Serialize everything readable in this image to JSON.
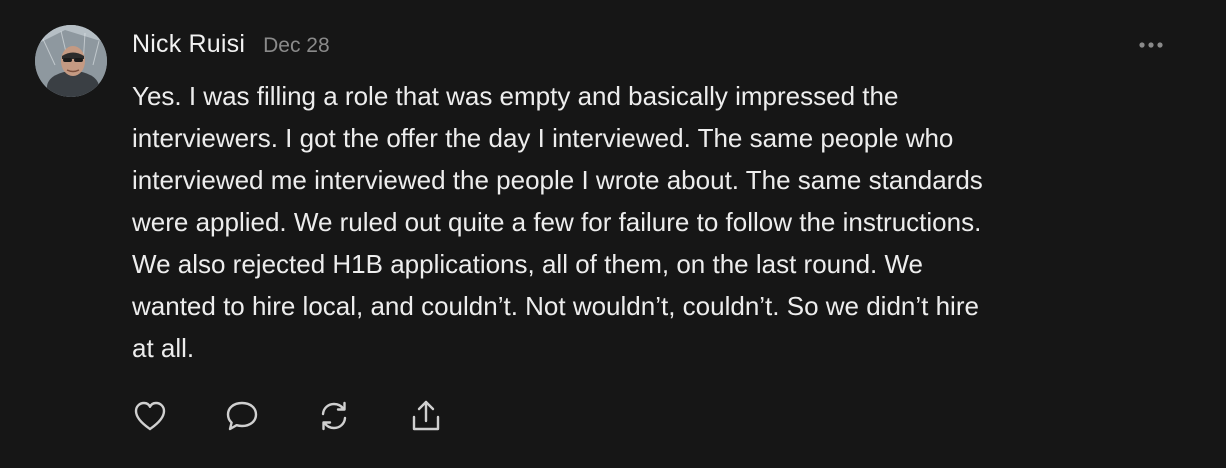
{
  "comment": {
    "author": "Nick Ruisi",
    "date": "Dec 28",
    "lines": [
      "Yes. I was filling a role that was empty and basically impressed the",
      "interviewers. I got the offer the day I interviewed. The same people who",
      "interviewed me interviewed the people I wrote about. The same standards",
      "were applied. We ruled out quite a few for failure to follow the instructions.",
      "We also rejected H1B applications, all of them, on the last round. We",
      "wanted to hire local, and couldn’t. Not wouldn’t, couldn’t. So we didn’t hire",
      "at all."
    ]
  },
  "icons": {
    "avatar": "user-avatar-photo",
    "more": "ellipsis-icon",
    "like": "heart-icon",
    "reply": "comment-bubble-icon",
    "restack": "restack-icon",
    "share": "share-icon"
  },
  "colors": {
    "background": "#161616",
    "text": "#ededed",
    "muted": "#8a8a8a",
    "icon": "#d0d0d0"
  }
}
